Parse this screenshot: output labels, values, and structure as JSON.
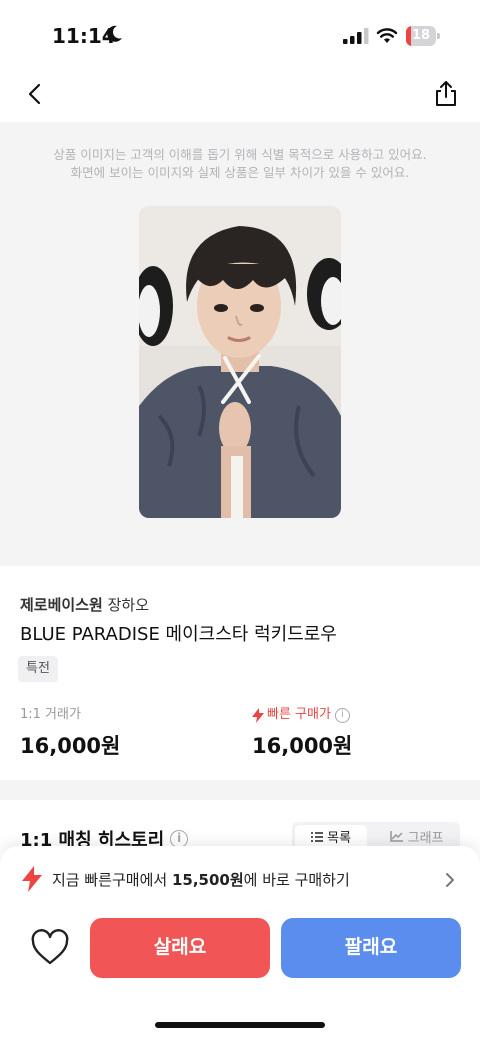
{
  "status_bar": {
    "time": "11:14",
    "battery": "18",
    "battery_level": 0.18
  },
  "product_image": {
    "notice_line1": "상품 이미지는 고객의 이해를 돕기 위해 식별 목적으로 사용하고 있어요.",
    "notice_line2": "화면에 보이는 이미지와 실제 상품은 일부 차이가 있을 수 있어요."
  },
  "product": {
    "group": "제로베이스원",
    "member": "장하오",
    "title": "BLUE PARADISE 메이크스타 럭키드로우",
    "tag": "특전"
  },
  "prices": {
    "trade_label": "1:1 거래가",
    "trade_value": "16,000원",
    "fast_label": "빠른 구매가",
    "fast_value": "16,000원"
  },
  "history": {
    "title": "1:1 매칭 히스토리",
    "list_label": "목록",
    "graph_label": "그래프"
  },
  "quick_buy": {
    "prefix": "지금 빠른구매에서",
    "price": "15,500원",
    "suffix": "에 바로 구매하기"
  },
  "actions": {
    "buy": "살래요",
    "sell": "팔래요"
  },
  "colors": {
    "buy": "#f25555",
    "sell": "#5b8def",
    "fast": "#ef4444"
  }
}
